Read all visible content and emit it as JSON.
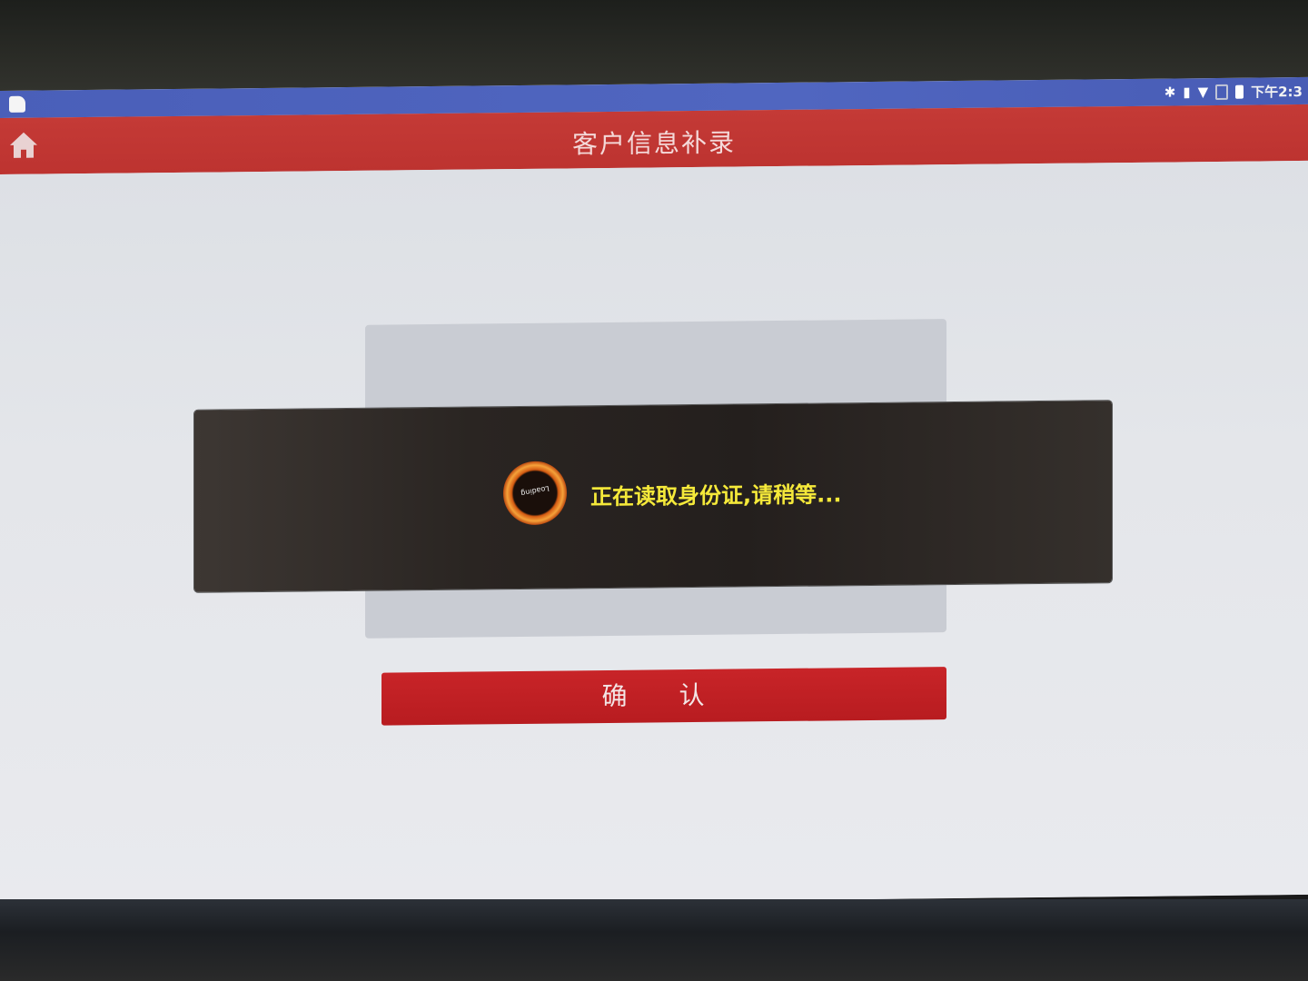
{
  "status_bar": {
    "time": "下午2:3",
    "icons": [
      "notification-icon",
      "bluetooth-icon",
      "vibrate-icon",
      "wifi-icon",
      "no-sim-icon",
      "battery-icon"
    ]
  },
  "header": {
    "title": "客户信息补录",
    "home_icon": "home-icon",
    "background_color": "#c43a36"
  },
  "loading_dialog": {
    "spinner_label": "Loading",
    "message": "正在读取身份证,请稍等...",
    "message_color": "#f5e93a"
  },
  "main": {
    "confirm_label": "确 认",
    "confirm_color": "#c82428"
  },
  "navigation": {
    "items": [
      "back-icon",
      "home-icon",
      "recent-apps-icon"
    ]
  }
}
